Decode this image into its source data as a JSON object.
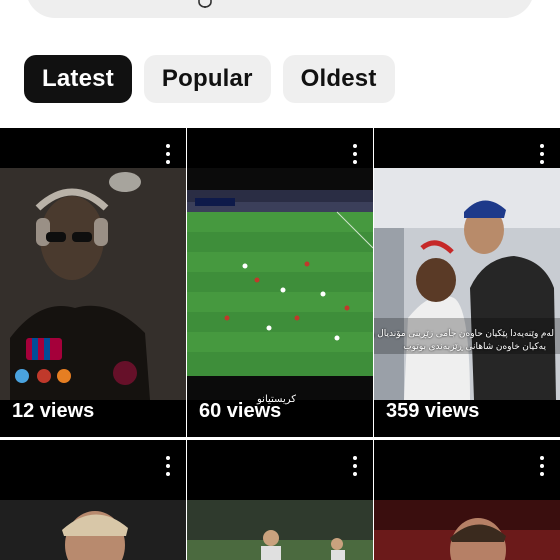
{
  "search": {
    "mic_icon": "microphone-icon"
  },
  "chips": [
    {
      "label": "Latest",
      "active": true
    },
    {
      "label": "Popular",
      "active": false
    },
    {
      "label": "Oldest",
      "active": false
    }
  ],
  "videos": [
    {
      "views": "12 views",
      "thumb": "dark-portrait-headphones"
    },
    {
      "views": "60 views",
      "thumb": "football-match-pitch",
      "overlay": "كريستيانو"
    },
    {
      "views": "359 views",
      "thumb": "two-players-photo",
      "overlay": "لەم وێنەیەدا پێکیان حاوەن جامی زێڕینی مۆندیال و",
      "overlay2": "یەکیان خاوەن شاهانی ڕێزبەندی بوتوب"
    },
    {
      "views": "",
      "thumb": "player-blond-hair"
    },
    {
      "views": "",
      "thumb": "stadium-pitch"
    },
    {
      "views": "",
      "thumb": "player-red-background"
    }
  ],
  "colors": {
    "chip_active_bg": "#111111",
    "chip_bg": "#efefef",
    "page_bg": "#ffffff"
  }
}
